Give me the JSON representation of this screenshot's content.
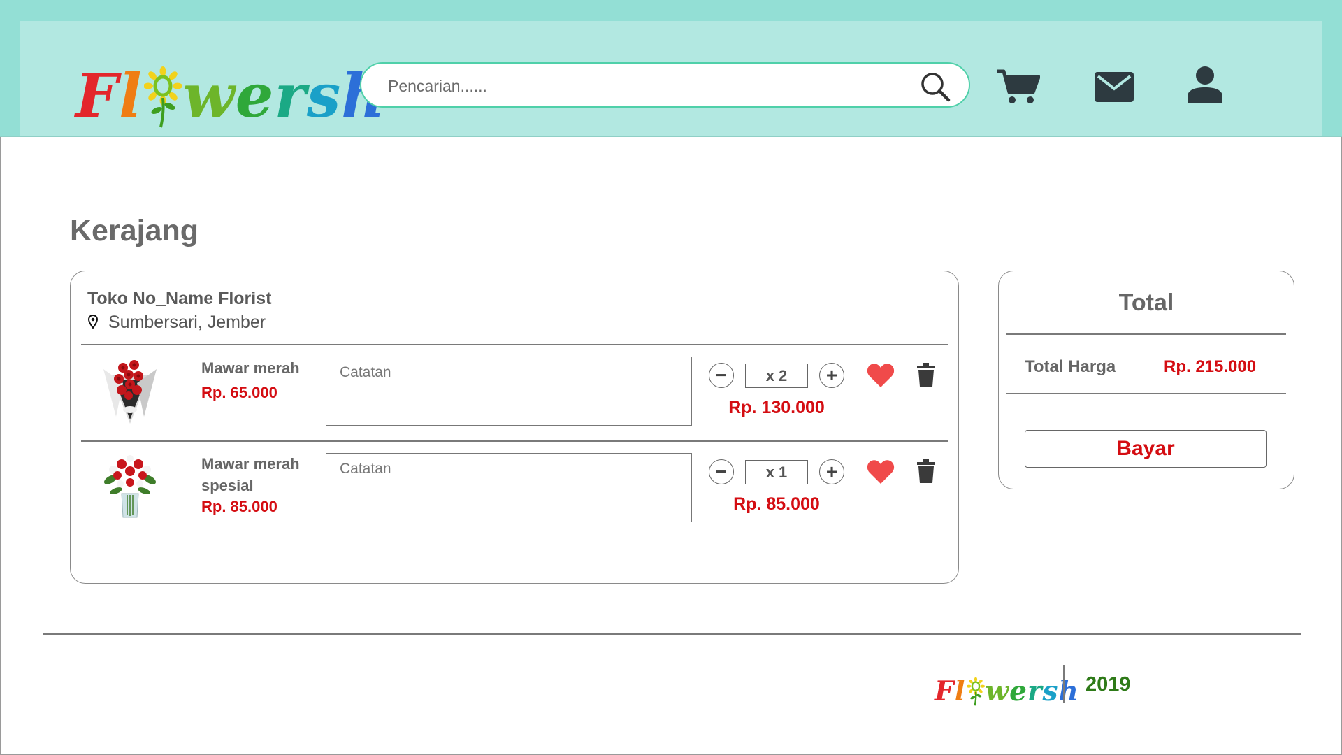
{
  "header": {
    "logo_text": "Flowersh",
    "search_placeholder": "Pencarian......",
    "icons": [
      "search-icon",
      "cart-icon",
      "mail-icon",
      "user-icon"
    ]
  },
  "page": {
    "title": "Kerajang"
  },
  "store": {
    "name": "Toko No_Name Florist",
    "location": "Sumbersari, Jember"
  },
  "items": [
    {
      "name": "Mawar merah",
      "price": "Rp. 65.000",
      "note_placeholder": "Catatan",
      "quantity": "x 2",
      "subtotal": "Rp. 130.000"
    },
    {
      "name": "Mawar merah spesial",
      "price": "Rp. 85.000",
      "note_placeholder": "Catatan",
      "quantity": "x 1",
      "subtotal": "Rp. 85.000"
    }
  ],
  "summary": {
    "title": "Total",
    "label": "Total Harga",
    "value": "Rp. 215.000",
    "pay_label": "Bayar"
  },
  "footer": {
    "logo_text": "Flowersh",
    "year": "2019"
  },
  "colors": {
    "header": "#93dfd5",
    "header_inner": "#b2e8e1",
    "price_red": "#d40d12",
    "heart": "#f04a4a",
    "year_green": "#2e7a18"
  }
}
